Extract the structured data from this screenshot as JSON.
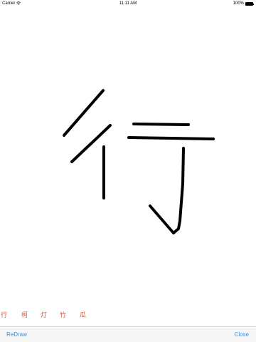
{
  "status_bar": {
    "carrier": "Carrier",
    "time": "11:11 AM",
    "battery_text": "100%",
    "battery_level": 1.0,
    "wifi_icon": "wifi-icon"
  },
  "drawing": {
    "character": "行",
    "stroke_color": "#000000"
  },
  "candidates": [
    "行",
    "柯",
    "灯",
    "竹",
    "瓜"
  ],
  "toolbar": {
    "redraw_label": "ReDraw",
    "close_label": "Close",
    "accent_color": "#3a8fe0"
  },
  "colors": {
    "candidate": "#d8563a",
    "toolbar_bg": "#f6f6f7"
  }
}
